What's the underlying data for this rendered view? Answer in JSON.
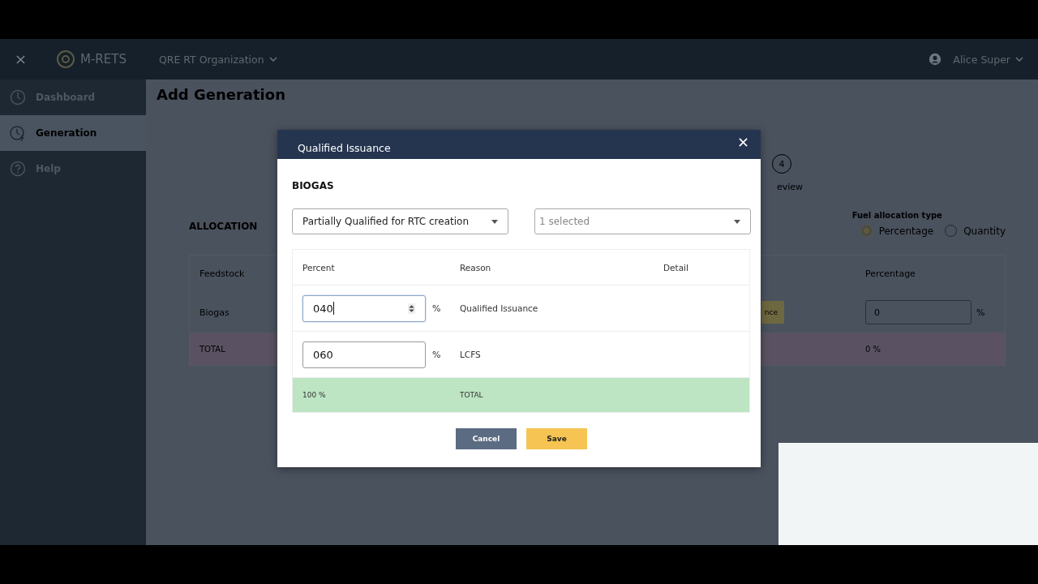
{
  "header": {
    "logo": "M-RETS",
    "organization": "QRE RT Organization",
    "user": "Alice Super"
  },
  "sidebar": {
    "items": [
      {
        "label": "Dashboard",
        "selected": false
      },
      {
        "label": "Generation",
        "selected": true
      },
      {
        "label": "Help",
        "selected": false
      }
    ]
  },
  "page": {
    "title": "Add Generation",
    "step": {
      "number": "4",
      "label": "eview"
    },
    "allocation": {
      "title": "ALLOCATION",
      "type_label": "Fuel allocation type",
      "type_options": [
        {
          "label": "Percentage",
          "selected": true
        },
        {
          "label": "Quantity",
          "selected": false
        }
      ],
      "columns": [
        "Feedstock",
        "Percentage"
      ],
      "row": {
        "feedstock": "Biogas",
        "button": "nce",
        "value": "0",
        "unit": "%"
      },
      "total": {
        "label": "TOTAL",
        "value": "0 %"
      }
    }
  },
  "modal": {
    "title": "Qualified Issuance",
    "section": "BIOGAS",
    "select_value": "Partially Qualified for RTC creation",
    "multiselect_placeholder": "1 selected",
    "columns": [
      "Percent",
      "Reason",
      "Detail"
    ],
    "rows": [
      {
        "value": "040",
        "unit": "%",
        "reason": "Qualified Issuance",
        "focused": true
      },
      {
        "value": "060",
        "unit": "%",
        "reason": "LCFS",
        "focused": false
      }
    ],
    "total": {
      "percent": "100 %",
      "label": "TOTAL"
    },
    "buttons": [
      {
        "label": "Cancel",
        "kind": "secondary"
      },
      {
        "label": "Save",
        "kind": "primary"
      }
    ]
  }
}
